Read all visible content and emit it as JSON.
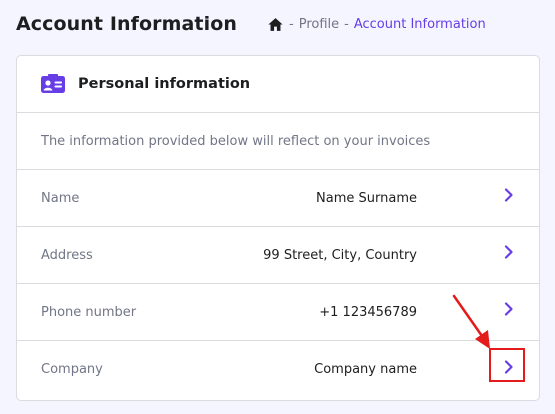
{
  "header": {
    "title": "Account Information",
    "breadcrumb": {
      "home_icon": "home-icon",
      "separator": "-",
      "items": [
        "Profile",
        "Account Information"
      ]
    }
  },
  "card": {
    "icon": "id-card-icon",
    "title": "Personal information",
    "subtitle": "The information provided below will reflect on your invoices",
    "rows": [
      {
        "label": "Name",
        "value": "Name Surname"
      },
      {
        "label": "Address",
        "value": "99 Street, City, Country"
      },
      {
        "label": "Phone number",
        "value": "+1 123456789"
      },
      {
        "label": "Company",
        "value": "Company name"
      }
    ]
  },
  "colors": {
    "accent": "#673de6",
    "annotation": "#e31b1b",
    "text": "#1d1e20",
    "muted": "#727586",
    "border": "#dadce0",
    "background": "#f4f5ff"
  }
}
